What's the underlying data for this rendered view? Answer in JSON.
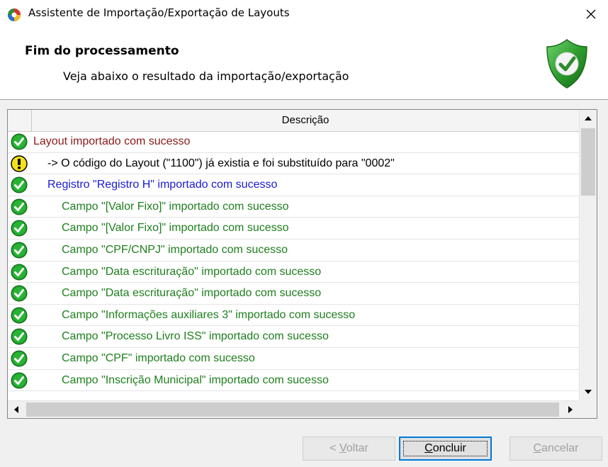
{
  "window": {
    "title": "Assistente de Importação/Exportação de Layouts"
  },
  "header": {
    "title": "Fim do processamento",
    "subtitle": "Veja abaixo o resultado da importação/exportação"
  },
  "grid": {
    "column_description": "Descrição",
    "rows": [
      {
        "status": "success",
        "text": "Layout importado com sucesso",
        "color": "#8b1a1a",
        "indent": 0
      },
      {
        "status": "warning",
        "text": "-> O código do Layout (\"1100\") já existia e foi substituído para \"0002\"",
        "color": "#000000",
        "indent": 1
      },
      {
        "status": "success",
        "text": "Registro \"Registro H\" importado com sucesso",
        "color": "#1a1ad4",
        "indent": 1
      },
      {
        "status": "success",
        "text": "Campo \"[Valor Fixo]\" importado com sucesso",
        "color": "#1e7f1e",
        "indent": 2
      },
      {
        "status": "success",
        "text": "Campo \"[Valor Fixo]\" importado com sucesso",
        "color": "#1e7f1e",
        "indent": 2
      },
      {
        "status": "success",
        "text": "Campo \"CPF/CNPJ\" importado com sucesso",
        "color": "#1e7f1e",
        "indent": 2
      },
      {
        "status": "success",
        "text": "Campo \"Data escrituração\" importado com sucesso",
        "color": "#1e7f1e",
        "indent": 2
      },
      {
        "status": "success",
        "text": "Campo \"Data escrituração\" importado com sucesso",
        "color": "#1e7f1e",
        "indent": 2
      },
      {
        "status": "success",
        "text": "Campo \"Informações auxiliares 3\" importado com sucesso",
        "color": "#1e7f1e",
        "indent": 2
      },
      {
        "status": "success",
        "text": "Campo \"Processo Livro ISS\" importado com sucesso",
        "color": "#1e7f1e",
        "indent": 2
      },
      {
        "status": "success",
        "text": "Campo \"CPF\" importado com sucesso",
        "color": "#1e7f1e",
        "indent": 2
      },
      {
        "status": "success",
        "text": "Campo \"Inscrição Municipal\" importado com sucesso",
        "color": "#1e7f1e",
        "indent": 2
      }
    ]
  },
  "buttons": {
    "back_pre": "< ",
    "back_accel": "V",
    "back_post": "oltar",
    "finish_accel": "C",
    "finish_post": "oncluir",
    "cancel_accel": "C",
    "cancel_post": "ancelar"
  }
}
